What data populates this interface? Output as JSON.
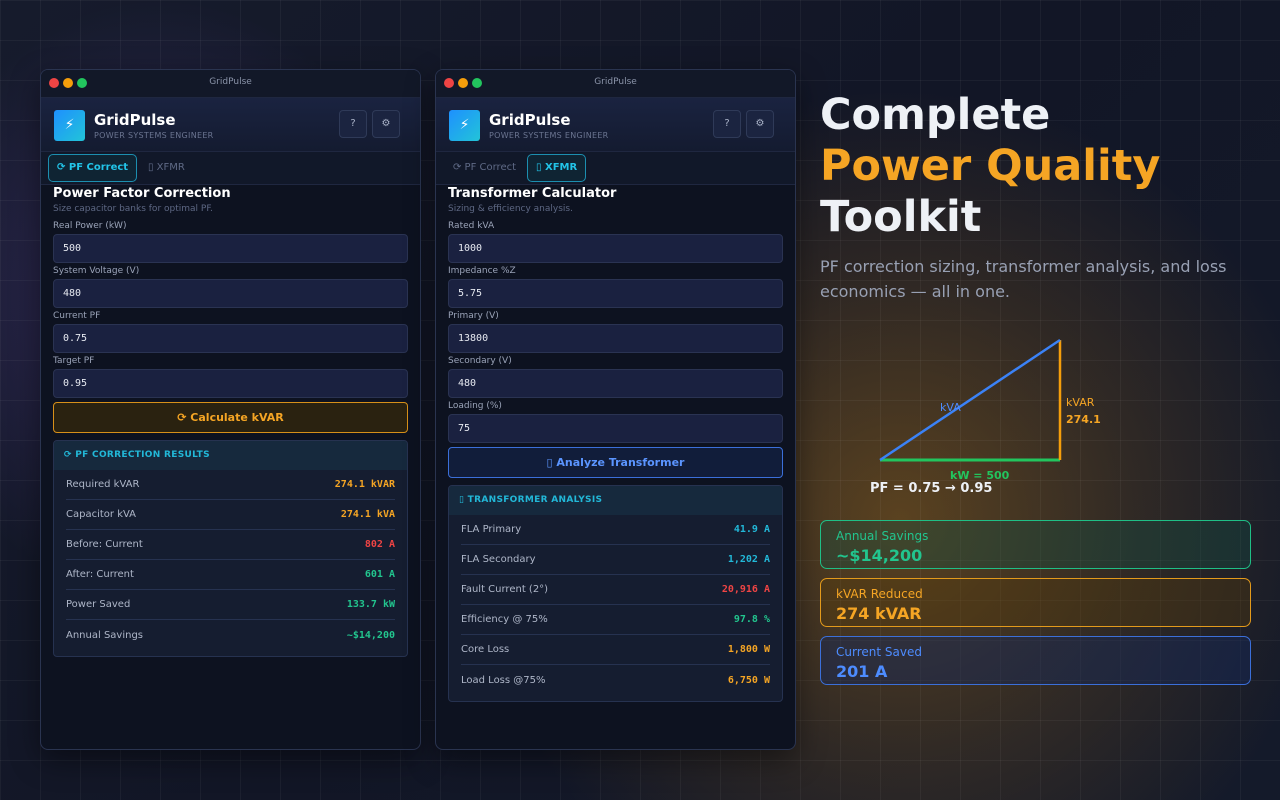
{
  "app": {
    "window_title": "GridPulse",
    "name": "GridPulse",
    "subtitle": "POWER SYSTEMS ENGINEER",
    "help_label": "?",
    "settings_label": "⚙",
    "tabs": {
      "pf": "⟳ PF Correct",
      "xfmr": "▯ XFMR"
    }
  },
  "pf_panel": {
    "title": "Power Factor Correction",
    "subtitle": "Size capacitor banks for optimal PF.",
    "fields": [
      {
        "label": "Real Power (kW)",
        "value": "500"
      },
      {
        "label": "System Voltage (V)",
        "value": "480"
      },
      {
        "label": "Current PF",
        "value": "0.75"
      },
      {
        "label": "Target PF",
        "value": "0.95"
      }
    ],
    "button": "⟳  Calculate kVAR",
    "results_title": "⟳ PF CORRECTION RESULTS",
    "results": [
      {
        "label": "Required kVAR",
        "value": "274.1 kVAR",
        "color": "#f5a524"
      },
      {
        "label": "Capacitor kVA",
        "value": "274.1 kVA",
        "color": "#f5a524"
      },
      {
        "label": "Before: Current",
        "value": "802 A",
        "color": "#ef4444"
      },
      {
        "label": "After: Current",
        "value": "601 A",
        "color": "#22c58e"
      },
      {
        "label": "Power Saved",
        "value": "133.7 kW",
        "color": "#22c58e"
      },
      {
        "label": "Annual Savings",
        "value": "~$14,200",
        "color": "#22c58e"
      }
    ]
  },
  "xfmr_panel": {
    "title": "Transformer Calculator",
    "subtitle": "Sizing & efficiency analysis.",
    "fields": [
      {
        "label": "Rated kVA",
        "value": "1000"
      },
      {
        "label": "Impedance %Z",
        "value": "5.75"
      },
      {
        "label": "Primary (V)",
        "value": "13800"
      },
      {
        "label": "Secondary (V)",
        "value": "480"
      },
      {
        "label": "Loading (%)",
        "value": "75"
      }
    ],
    "button": "▯  Analyze Transformer",
    "results_title": "▯ TRANSFORMER ANALYSIS",
    "results": [
      {
        "label": "FLA Primary",
        "value": "41.9 A",
        "color": "#22b8d8"
      },
      {
        "label": "FLA Secondary",
        "value": "1,202 A",
        "color": "#22b8d8"
      },
      {
        "label": "Fault Current (2°)",
        "value": "20,916 A",
        "color": "#ef4444"
      },
      {
        "label": "Efficiency @ 75%",
        "value": "97.8 %",
        "color": "#22c58e"
      },
      {
        "label": "Core Loss",
        "value": "1,800 W",
        "color": "#f5a524"
      },
      {
        "label": "Load Loss @75%",
        "value": "6,750 W",
        "color": "#f5a524"
      }
    ]
  },
  "hero": {
    "line1": "Complete",
    "line2": "Power Quality",
    "line3": "Toolkit",
    "description": "PF correction sizing, transformer analysis, and loss economics — all in one."
  },
  "triangle": {
    "kva_label": "kVA",
    "kvar_label": "kVAR",
    "kvar_value": "274.1",
    "kw_label": "kW = 500",
    "pf_label": "PF = 0.75 → 0.95"
  },
  "stats": [
    {
      "label": "Annual Savings",
      "value": "~$14,200"
    },
    {
      "label": "kVAR Reduced",
      "value": "274 kVAR"
    },
    {
      "label": "Current Saved",
      "value": "201 A"
    }
  ],
  "colors": {
    "accent_orange": "#f5a524",
    "accent_cyan": "#22c4e8",
    "accent_green": "#22c58e",
    "accent_blue": "#4d8cff",
    "danger_red": "#ef4444"
  }
}
